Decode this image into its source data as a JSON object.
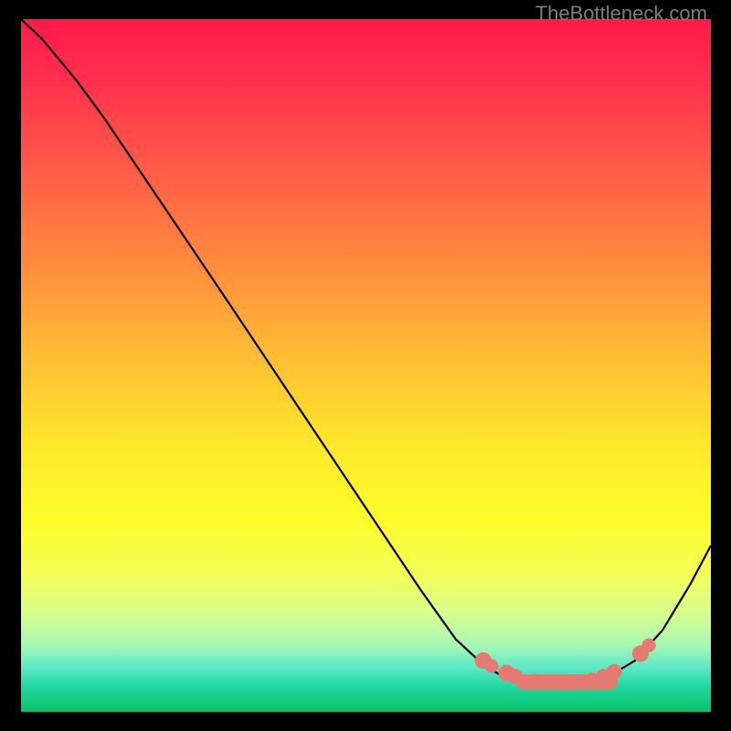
{
  "watermark": "TheBottleneck.com",
  "chart_data": {
    "type": "line",
    "title": "",
    "xlabel": "",
    "ylabel": "",
    "xlim": [
      0,
      100
    ],
    "ylim": [
      0,
      100
    ],
    "gradient_stops": [
      {
        "offset": 0.0,
        "color": "#ff1a4b"
      },
      {
        "offset": 0.08,
        "color": "#ff2d4e"
      },
      {
        "offset": 0.2,
        "color": "#ff5648"
      },
      {
        "offset": 0.35,
        "color": "#ff8a3e"
      },
      {
        "offset": 0.5,
        "color": "#ffc233"
      },
      {
        "offset": 0.62,
        "color": "#ffe92a"
      },
      {
        "offset": 0.72,
        "color": "#fdfc2a"
      },
      {
        "offset": 0.8,
        "color": "#f4ff57"
      },
      {
        "offset": 0.86,
        "color": "#d6fe8e"
      },
      {
        "offset": 0.905,
        "color": "#a5f8b6"
      },
      {
        "offset": 0.935,
        "color": "#5fe9c8"
      },
      {
        "offset": 0.965,
        "color": "#1ed79e"
      },
      {
        "offset": 1.0,
        "color": "#0cc16a"
      }
    ],
    "curve": [
      {
        "x": 0.0,
        "y": 100.0
      },
      {
        "x": 3.0,
        "y": 97.2
      },
      {
        "x": 8.0,
        "y": 91.2
      },
      {
        "x": 12.0,
        "y": 85.8
      },
      {
        "x": 20.0,
        "y": 74.0
      },
      {
        "x": 30.0,
        "y": 59.2
      },
      {
        "x": 40.0,
        "y": 44.3
      },
      {
        "x": 50.0,
        "y": 29.4
      },
      {
        "x": 58.0,
        "y": 17.5
      },
      {
        "x": 63.0,
        "y": 10.5
      },
      {
        "x": 67.0,
        "y": 6.8
      },
      {
        "x": 70.0,
        "y": 5.0
      },
      {
        "x": 74.0,
        "y": 4.1
      },
      {
        "x": 78.0,
        "y": 3.9
      },
      {
        "x": 82.0,
        "y": 4.3
      },
      {
        "x": 86.0,
        "y": 5.6
      },
      {
        "x": 89.0,
        "y": 7.4
      },
      {
        "x": 93.0,
        "y": 11.8
      },
      {
        "x": 97.0,
        "y": 18.4
      },
      {
        "x": 100.0,
        "y": 24.0
      }
    ],
    "markers": [
      {
        "x": 67.0,
        "y": 7.4,
        "r": 1.2
      },
      {
        "x": 68.2,
        "y": 6.6,
        "r": 1.0
      },
      {
        "x": 70.4,
        "y": 5.6,
        "r": 1.2
      },
      {
        "x": 71.6,
        "y": 5.1,
        "r": 1.1
      },
      {
        "x": 74.6,
        "y": 4.5,
        "r": 1.0
      },
      {
        "x": 76.8,
        "y": 4.2,
        "r": 1.0
      },
      {
        "x": 78.6,
        "y": 4.1,
        "r": 1.0
      },
      {
        "x": 80.0,
        "y": 4.2,
        "r": 1.0
      },
      {
        "x": 81.4,
        "y": 4.4,
        "r": 1.0
      },
      {
        "x": 82.8,
        "y": 4.7,
        "r": 1.0
      },
      {
        "x": 84.4,
        "y": 5.2,
        "r": 1.0
      },
      {
        "x": 86.0,
        "y": 5.8,
        "r": 1.1
      },
      {
        "x": 89.8,
        "y": 8.4,
        "r": 1.2
      },
      {
        "x": 91.0,
        "y": 9.6,
        "r": 1.0
      }
    ],
    "marker_pills": [
      {
        "x0": 72.8,
        "x1": 85.4,
        "y": 4.3,
        "r": 1.1
      }
    ]
  }
}
